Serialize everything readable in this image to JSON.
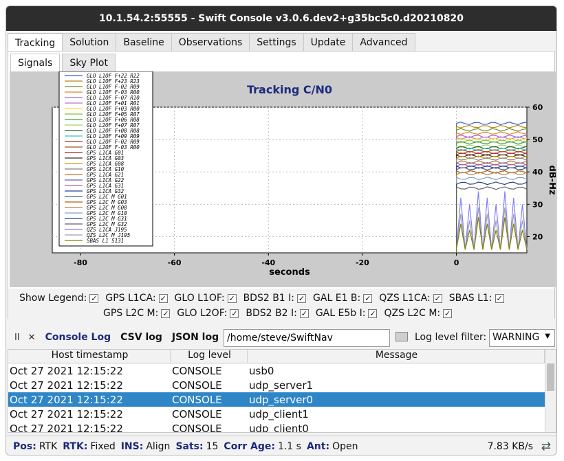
{
  "window": {
    "title": "10.1.54.2:55555 - Swift Console v3.0.6.dev2+g35bc5c0.d20210820"
  },
  "main_tabs": [
    "Tracking",
    "Solution",
    "Baseline",
    "Observations",
    "Settings",
    "Update",
    "Advanced"
  ],
  "sub_tabs": [
    "Signals",
    "Sky Plot"
  ],
  "chart_data": {
    "type": "line",
    "title": "Tracking C/N0",
    "xlabel": "seconds",
    "ylabel": "dB-Hz",
    "xlim": [
      -86,
      15
    ],
    "ylim": [
      15,
      60
    ],
    "xticks": [
      -80,
      -60,
      -40,
      -20,
      0
    ],
    "yticks": [
      20,
      30,
      40,
      50,
      60
    ],
    "grid": true,
    "legend_position": "top-left",
    "legend": [
      "GLO L1OF F+22 R22",
      "GLO L1OF F+23 R23",
      "GLO L1OF F-02 R09",
      "GLO L1OF F-03 R00",
      "GLO L1OF F-07 R10",
      "GLO L2OF F+01 R01",
      "GLO L2OF F+03 R00",
      "GLO L2OF F+05 R07",
      "GLO L2OF F+06 R08",
      "GLO L2OF F+07 R07",
      "GLO L2OF F+08 R08",
      "GLO L2OF F+09 R09",
      "GLO L2OF F-02 R09",
      "GLO L2OF F-03 R00",
      "GPS L1CA G01",
      "GPS L1CA G03",
      "GPS L1CA G08",
      "GPS L1CA G10",
      "GPS L1CA G21",
      "GPS L1CA G22",
      "GPS L1CA G31",
      "GPS L1CA G32",
      "GPS L2C M G01",
      "GPS L2C M G03",
      "GPS L2C M G08",
      "GPS L2C M G10",
      "GPS L2C M G31",
      "GPS L2C M G32",
      "QZS L1CA J195",
      "QZS L2C M J195",
      "SBAS L1 S131"
    ],
    "series_colors": [
      "#3b5bd6",
      "#b8860b",
      "#6b8e23",
      "#e8802a",
      "#9b6bd6",
      "#c86bd6",
      "#f0e020",
      "#80c040",
      "#40a040",
      "#a0d060",
      "#206020",
      "#40c0c0",
      "#8b4513",
      "#a0522d",
      "#b22222",
      "#303030",
      "#c8a000",
      "#808080",
      "#d07020",
      "#6060c0",
      "#c06080",
      "#2040a0",
      "#406080",
      "#a06020",
      "#c08040",
      "#80a0c0",
      "#204080",
      "#606060",
      "#8080ff",
      "#a0a0a0",
      "#808000"
    ],
    "levels": [
      55,
      54,
      53,
      52,
      51,
      50.5,
      50,
      49.5,
      49,
      48,
      47.5,
      47,
      46.5,
      46,
      45.5,
      45,
      44.5,
      44,
      43,
      42.5,
      42,
      41.5,
      41,
      40,
      39.5,
      38,
      36.5,
      35,
      30,
      25,
      22
    ]
  },
  "legend_toggles": {
    "show_legend": {
      "label": "Show Legend:",
      "checked": true
    },
    "row1": [
      "GPS L1CA:",
      "GLO L1OF:",
      "BDS2 B1 I:",
      "GAL E1 B:",
      "QZS L1CA:",
      "SBAS L1:"
    ],
    "row2": [
      "GPS L2C M:",
      "GLO L2OF:",
      "BDS2 B2 I:",
      "GAL E5b I:",
      "QZS L2C M:"
    ],
    "check": "✓"
  },
  "console": {
    "pause": "II",
    "clear": "✕",
    "tabs": [
      "Console Log",
      "CSV log",
      "JSON log"
    ],
    "path": "/home/steve/SwiftNav",
    "filter_label": "Log level filter:",
    "filter_value": "WARNING",
    "columns": [
      "Host timestamp",
      "Log level",
      "Message"
    ],
    "rows": [
      {
        "ts": "Oct 27 2021 12:15:22",
        "level": "CONSOLE",
        "msg": "usb0"
      },
      {
        "ts": "Oct 27 2021 12:15:22",
        "level": "CONSOLE",
        "msg": "udp_server1"
      },
      {
        "ts": "Oct 27 2021 12:15:22",
        "level": "CONSOLE",
        "msg": "udp_server0"
      },
      {
        "ts": "Oct 27 2021 12:15:22",
        "level": "CONSOLE",
        "msg": "udp_client1"
      },
      {
        "ts": "Oct 27 2021 12:15:22",
        "level": "CONSOLE",
        "msg": "udp_client0"
      }
    ],
    "selected_row": 2
  },
  "status": {
    "pos_label": "Pos:",
    "pos": "RTK",
    "rtk_label": "RTK:",
    "rtk": "Fixed",
    "ins_label": "INS:",
    "ins": "Align",
    "sats_label": "Sats:",
    "sats": "15",
    "corr_label": "Corr Age:",
    "corr": "1.1 s",
    "ant_label": "Ant:",
    "ant": "Open",
    "rate": "7.83 KB/s"
  },
  "colors": {
    "accent": "#1b2a7a",
    "selection": "#2f86c7",
    "plot_bg": "#cbcbcb"
  }
}
